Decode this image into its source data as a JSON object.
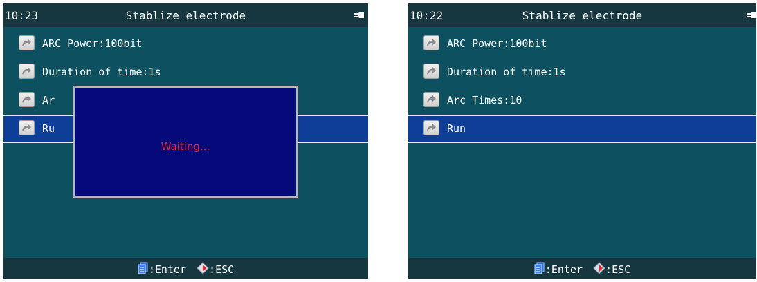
{
  "left_screen": {
    "time": "10:23",
    "title": "Stablize electrode",
    "items": [
      {
        "label": "ARC Power:100bit"
      },
      {
        "label": "Duration of time:1s"
      },
      {
        "label": "Ar"
      },
      {
        "label": "Ru"
      }
    ],
    "selected_index": 3,
    "dialog": {
      "message": "Waiting..."
    },
    "footer": {
      "enter_label": ":Enter",
      "esc_label": ":ESC"
    }
  },
  "right_screen": {
    "time": "10:22",
    "title": "Stablize electrode",
    "items": [
      {
        "label": "ARC Power:100bit"
      },
      {
        "label": "Duration of time:1s"
      },
      {
        "label": "Arc Times:10"
      },
      {
        "label": "Run"
      }
    ],
    "selected_index": 3,
    "footer": {
      "enter_label": ":Enter",
      "esc_label": ":ESC"
    }
  },
  "colors": {
    "screen_bg": "#0d5160",
    "bar_bg": "#16373f",
    "selected_bg": "#0d3f99",
    "dialog_bg": "#06097a",
    "waiting_text": "#e2252b"
  },
  "icons": {
    "status": "plug-icon",
    "item": "arrow-icon",
    "enter": "enter-icon",
    "esc": "esc-icon"
  }
}
